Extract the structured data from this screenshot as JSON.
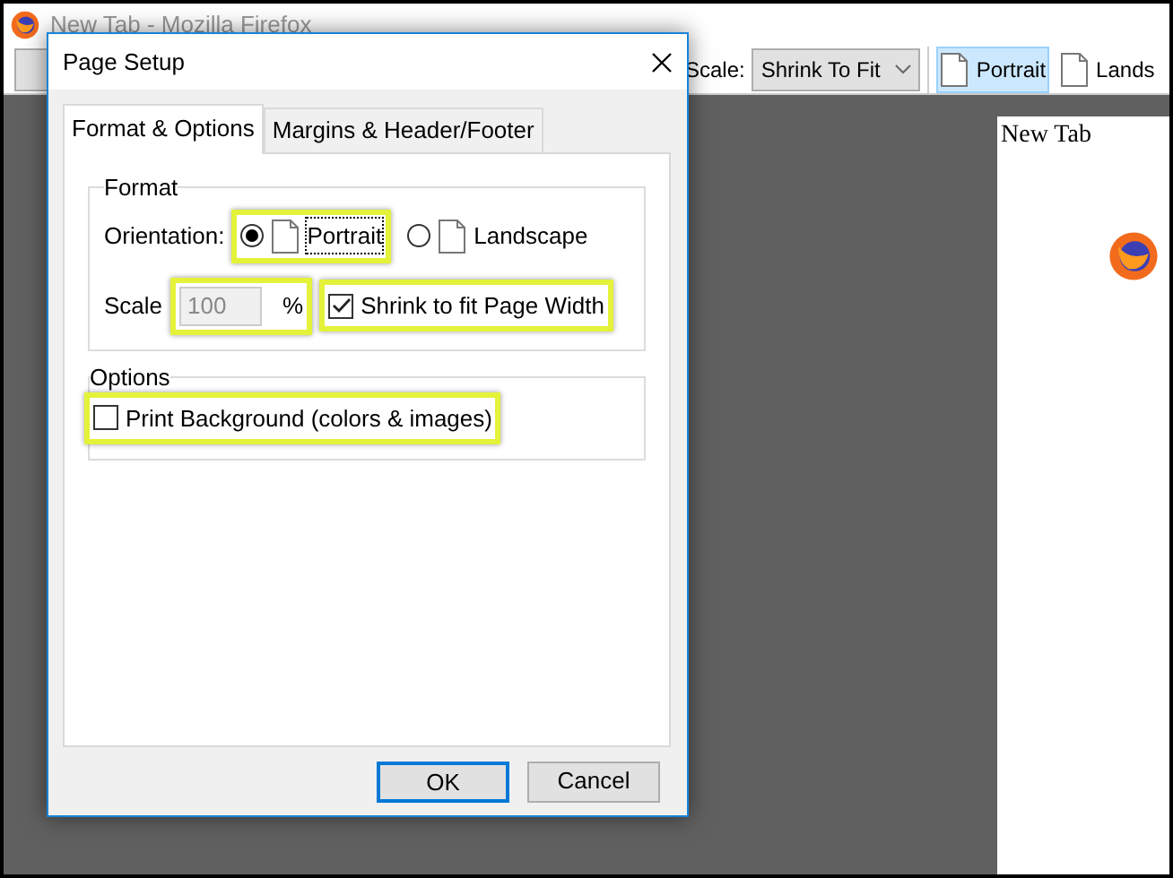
{
  "window": {
    "title": "New Tab - Mozilla Firefox"
  },
  "toolbar": {
    "scale_label": "Scale:",
    "scale_select": "Shrink To Fit",
    "orientation_buttons": [
      {
        "label": "Portrait",
        "selected": true
      },
      {
        "label": "Lands",
        "selected": false
      }
    ]
  },
  "preview": {
    "page_header": "New Tab"
  },
  "dialog": {
    "title": "Page Setup",
    "tabs": [
      {
        "label": "Format & Options",
        "selected": true
      },
      {
        "label": "Margins & Header/Footer",
        "selected": false
      }
    ],
    "format": {
      "legend": "Format",
      "orientation_label": "Orientation:",
      "orientations": [
        {
          "label": "Portrait",
          "selected": true,
          "highlighted": true
        },
        {
          "label": "Landscape",
          "selected": false,
          "highlighted": false
        }
      ],
      "scale_label": "Scale",
      "scale_value": "100",
      "scale_disabled": true,
      "scale_unit": "%",
      "scale_highlighted": true,
      "shrink": {
        "label": "Shrink to fit Page Width",
        "checked": true,
        "highlighted": true
      }
    },
    "options": {
      "legend": "Options",
      "print_background": {
        "label": "Print Background (colors & images)",
        "checked": false,
        "highlighted": true
      }
    },
    "buttons": [
      {
        "label": "OK",
        "default": true
      },
      {
        "label": "Cancel",
        "default": false
      }
    ]
  }
}
